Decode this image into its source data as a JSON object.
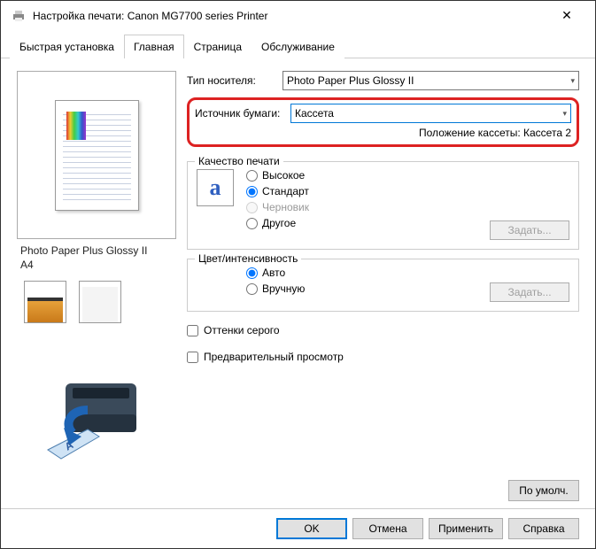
{
  "title": "Настройка печати: Canon MG7700 series Printer",
  "tabs": [
    "Быстрая установка",
    "Главная",
    "Страница",
    "Обслуживание"
  ],
  "active_tab": 1,
  "preview_label": "Photo Paper Plus Glossy II\nA4",
  "media_type": {
    "label": "Тип носителя:",
    "value": "Photo Paper Plus Glossy II"
  },
  "paper_source": {
    "label": "Источник бумаги:",
    "value": "Кассета"
  },
  "cassette_position": "Положение кассеты: Кассета 2",
  "quality": {
    "legend": "Качество печати",
    "options": [
      "Высокое",
      "Стандарт",
      "Черновик",
      "Другое"
    ],
    "selected": 1,
    "button": "Задать..."
  },
  "color": {
    "legend": "Цвет/интенсивность",
    "options": [
      "Авто",
      "Вручную"
    ],
    "selected": 0,
    "button": "Задать..."
  },
  "grayscale": "Оттенки серого",
  "preview_before": "Предварительный просмотр",
  "defaults": "По умолч.",
  "buttons": {
    "ok": "OK",
    "cancel": "Отмена",
    "apply": "Применить",
    "help": "Справка"
  }
}
